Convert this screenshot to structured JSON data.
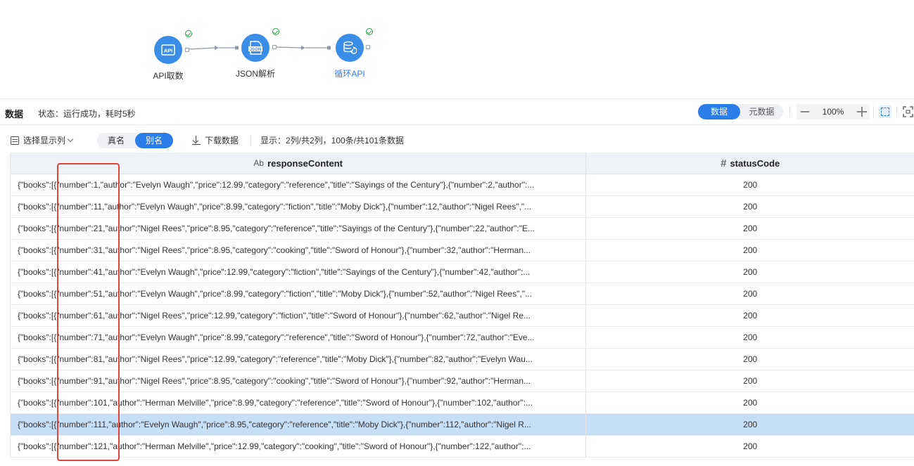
{
  "flow": {
    "nodes": [
      {
        "label": "API取数",
        "icon": "api-icon",
        "status": "success"
      },
      {
        "label": "JSON解析",
        "icon": "json-file-icon",
        "status": "success"
      },
      {
        "label": "循环API",
        "icon": "database-loop-icon",
        "status": "success",
        "selected": true
      }
    ]
  },
  "toolbar": {
    "title": "数据",
    "status": "状态：运行成功，耗时5秒",
    "view_tabs": [
      "数据",
      "元数据"
    ],
    "view_active": "数据",
    "zoom": "100%"
  },
  "table_toolbar": {
    "column_select_label": "选择显示列",
    "name_modes": [
      "真名",
      "别名"
    ],
    "name_active": "别名",
    "download_label": "下载数据",
    "display_info": "显示：2列/共2列，100条/共101条数据"
  },
  "table": {
    "columns": [
      {
        "type_icon": "Ab",
        "name": "responseContent"
      },
      {
        "type_icon": "#",
        "name": "statusCode"
      }
    ],
    "rows": [
      [
        "{\"books\":[{\"number\":1,\"author\":\"Evelyn Waugh\",\"price\":12.99,\"category\":\"reference\",\"title\":\"Sayings of the Century\"},{\"number\":2,\"author\":...",
        "200"
      ],
      [
        "{\"books\":[{\"number\":11,\"author\":\"Evelyn Waugh\",\"price\":8.99,\"category\":\"fiction\",\"title\":\"Moby Dick\"},{\"number\":12,\"author\":\"Nigel Rees\",\"...",
        "200"
      ],
      [
        "{\"books\":[{\"number\":21,\"author\":\"Nigel Rees\",\"price\":8.95,\"category\":\"reference\",\"title\":\"Sayings of the Century\"},{\"number\":22,\"author\":\"E...",
        "200"
      ],
      [
        "{\"books\":[{\"number\":31,\"author\":\"Nigel Rees\",\"price\":8.95,\"category\":\"cooking\",\"title\":\"Sword of Honour\"},{\"number\":32,\"author\":\"Herman...",
        "200"
      ],
      [
        "{\"books\":[{\"number\":41,\"author\":\"Evelyn Waugh\",\"price\":12.99,\"category\":\"fiction\",\"title\":\"Sayings of the Century\"},{\"number\":42,\"author\":...",
        "200"
      ],
      [
        "{\"books\":[{\"number\":51,\"author\":\"Evelyn Waugh\",\"price\":8.99,\"category\":\"fiction\",\"title\":\"Moby Dick\"},{\"number\":52,\"author\":\"Nigel Rees\",\"...",
        "200"
      ],
      [
        "{\"books\":[{\"number\":61,\"author\":\"Nigel Rees\",\"price\":12.99,\"category\":\"fiction\",\"title\":\"Sword of Honour\"},{\"number\":62,\"author\":\"Nigel Re...",
        "200"
      ],
      [
        "{\"books\":[{\"number\":71,\"author\":\"Evelyn Waugh\",\"price\":8.99,\"category\":\"reference\",\"title\":\"Sword of Honour\"},{\"number\":72,\"author\":\"Eve...",
        "200"
      ],
      [
        "{\"books\":[{\"number\":81,\"author\":\"Nigel Rees\",\"price\":12.99,\"category\":\"reference\",\"title\":\"Moby Dick\"},{\"number\":82,\"author\":\"Evelyn Wau...",
        "200"
      ],
      [
        "{\"books\":[{\"number\":91,\"author\":\"Nigel Rees\",\"price\":8.95,\"category\":\"cooking\",\"title\":\"Sword of Honour\"},{\"number\":92,\"author\":\"Herman...",
        "200"
      ],
      [
        "{\"books\":[{\"number\":101,\"author\":\"Herman Melville\",\"price\":8.99,\"category\":\"reference\",\"title\":\"Sword of Honour\"},{\"number\":102,\"author\":...",
        "200"
      ],
      [
        "{\"books\":[{\"number\":111,\"author\":\"Evelyn Waugh\",\"price\":8.95,\"category\":\"reference\",\"title\":\"Moby Dick\"},{\"number\":112,\"author\":\"Nigel R...",
        "200"
      ],
      [
        "{\"books\":[{\"number\":121,\"author\":\"Herman Melville\",\"price\":12.99,\"category\":\"cooking\",\"title\":\"Sword of Honour\"},{\"number\":122,\"author\":...",
        "200"
      ]
    ],
    "selected_row": 11
  },
  "colors": {
    "accent": "#2b7de9",
    "node": "#3b8ee8",
    "success": "#2aa24a",
    "highlight": "#e0453a",
    "selected_row": "#c7def7"
  }
}
